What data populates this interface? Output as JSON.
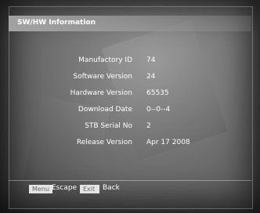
{
  "window": {
    "title": "SW/HW Information"
  },
  "info": {
    "rows": [
      {
        "label": "Manufactory ID",
        "value": "74"
      },
      {
        "label": "Software Version",
        "value": "24"
      },
      {
        "label": "Hardware Version",
        "value": "65535"
      },
      {
        "label": "Download Date",
        "value": "0--0--4"
      },
      {
        "label": "STB Serial No",
        "value": "2"
      },
      {
        "label": "Release Version",
        "value": "Apr 17 2008"
      }
    ]
  },
  "footer": {
    "menu_key": "Menu",
    "menu_action": "Escape",
    "exit_key": "Exit",
    "exit_action": "Back"
  },
  "colors": {
    "text": "#ffffff",
    "key_background": "#e4e4e4",
    "key_text": "#6a6a6a"
  }
}
